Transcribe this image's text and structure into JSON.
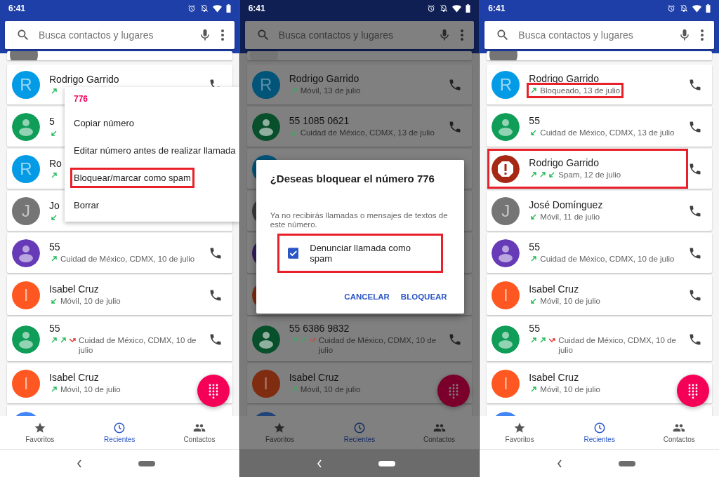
{
  "panels": [
    {
      "status_time": "6:41",
      "dimmed": false,
      "search": {
        "placeholder": "Busca contactos y lugares"
      },
      "calls": [
        {
          "kind": "partial_top",
          "avatar": {
            "kind": "plain",
            "color": "#757575"
          }
        },
        {
          "kind": "call",
          "avatar": {
            "kind": "letter",
            "letter": "R",
            "color": "#039be5"
          },
          "name": "Rodrigo Garrido",
          "arrows": [
            {
              "kind": "outgoing"
            }
          ]
        },
        {
          "kind": "call",
          "avatar": {
            "kind": "person",
            "color": "#0f9d58"
          },
          "name": "5",
          "arrows": [
            {
              "kind": "incoming"
            }
          ]
        },
        {
          "kind": "call",
          "avatar": {
            "kind": "letter",
            "letter": "R",
            "color": "#039be5"
          },
          "name": "Ro",
          "arrows": [
            {
              "kind": "outgoing"
            }
          ]
        },
        {
          "kind": "call",
          "avatar": {
            "kind": "letter",
            "letter": "J",
            "color": "#757575"
          },
          "name": "Jo",
          "arrows": [
            {
              "kind": "incoming"
            }
          ]
        },
        {
          "kind": "call",
          "avatar": {
            "kind": "person",
            "color": "#673ab7"
          },
          "name": "55",
          "arrows": [
            {
              "kind": "outgoing"
            }
          ],
          "subtitle": "Cuidad de México, CDMX, 10 de julio"
        },
        {
          "kind": "call",
          "avatar": {
            "kind": "letter",
            "letter": "I",
            "color": "#ff5722"
          },
          "name": "Isabel Cruz",
          "arrows": [
            {
              "kind": "incoming"
            }
          ],
          "subtitle": "Móvil, 10 de julio"
        },
        {
          "kind": "call",
          "avatar": {
            "kind": "person",
            "color": "#0f9d58"
          },
          "name": "55",
          "arrows": [
            {
              "kind": "outgoing"
            },
            {
              "kind": "outgoing"
            },
            {
              "kind": "missed"
            }
          ],
          "subtitle": "Cuidad de México, CDMX, 10 de julio"
        },
        {
          "kind": "call",
          "avatar": {
            "kind": "letter",
            "letter": "I",
            "color": "#ff5722"
          },
          "name": "Isabel Cruz",
          "arrows": [
            {
              "kind": "outgoing"
            }
          ],
          "subtitle": "Móvil, 10 de julio"
        },
        {
          "kind": "partial_bottom",
          "avatar": {
            "kind": "person",
            "color": "#4285f4"
          }
        }
      ],
      "menu": {
        "number": "776",
        "items": [
          {
            "label": "Copiar número",
            "highlighted": false
          },
          {
            "label": "Editar número antes de realizar llamada",
            "highlighted": false
          },
          {
            "label": "Bloquear/marcar como spam",
            "highlighted": true
          },
          {
            "label": "Borrar",
            "highlighted": false
          }
        ]
      },
      "nav": [
        {
          "kind": "star",
          "label": "Favoritos",
          "selected": false
        },
        {
          "kind": "clock",
          "label": "Recientes",
          "selected": true
        },
        {
          "kind": "people",
          "label": "Contactos",
          "selected": false
        }
      ]
    },
    {
      "status_time": "6:41",
      "dimmed": true,
      "search": {
        "placeholder": "Busca contactos y lugares"
      },
      "calls": [
        {
          "kind": "partial_top",
          "avatar": {
            "kind": "plain",
            "color": "#757575"
          }
        },
        {
          "kind": "call",
          "avatar": {
            "kind": "letter",
            "letter": "R",
            "color": "#025479"
          },
          "name": "Rodrigo Garrido",
          "arrows": [
            {
              "kind": "outgoing"
            }
          ],
          "subtitle": "Móvil, 13 de julio"
        },
        {
          "kind": "call",
          "avatar": {
            "kind": "person",
            "color": "#084f2c"
          },
          "name": "55 1085 0621",
          "arrows": [
            {
              "kind": "incoming"
            }
          ],
          "subtitle": "Cuidad de México, CDMX, 13 de julio"
        },
        {
          "kind": "call",
          "avatar": {
            "kind": "plain",
            "color": "#025479"
          }
        },
        {
          "kind": "call",
          "avatar": {
            "kind": "plain",
            "color": "#3b3b3b"
          }
        },
        {
          "kind": "call",
          "avatar": {
            "kind": "plain",
            "color": "#341d5c"
          }
        },
        {
          "kind": "call",
          "avatar": {
            "kind": "plain",
            "color": "#802c11"
          }
        },
        {
          "kind": "call",
          "avatar": {
            "kind": "person",
            "color": "#084f2c"
          },
          "name": "55 6386 9832",
          "arrows": [
            {
              "kind": "outgoing"
            },
            {
              "kind": "outgoing"
            },
            {
              "kind": "missed"
            }
          ],
          "subtitle": "Cuidad de México, CDMX, 10 de julio"
        },
        {
          "kind": "call",
          "avatar": {
            "kind": "letter",
            "letter": "I",
            "color": "#802c11"
          },
          "name": "Isabel Cruz",
          "arrows": [
            {
              "kind": "outgoing"
            }
          ],
          "subtitle": "Móvil, 10 de julio"
        },
        {
          "kind": "partial_bottom",
          "avatar": {
            "kind": "person",
            "color": "#21437a"
          }
        }
      ],
      "dialog": {
        "title": "¿Deseas bloquear el número 776",
        "message": "Ya no recibirás llamadas o mensajes de textos de este número.",
        "checkbox": {
          "label": "Denunciar llamada como spam",
          "checked": true,
          "highlighted": true
        },
        "buttons": [
          "CANCELAR",
          "BLOQUEAR"
        ]
      },
      "nav": [
        {
          "kind": "star",
          "label": "Favoritos",
          "selected": false
        },
        {
          "kind": "clock",
          "label": "Recientes",
          "selected": true
        },
        {
          "kind": "people",
          "label": "Contactos",
          "selected": false
        }
      ]
    },
    {
      "status_time": "6:41",
      "dimmed": false,
      "search": {
        "placeholder": "Busca contactos y lugares"
      },
      "calls": [
        {
          "kind": "partial_top",
          "avatar": {
            "kind": "plain",
            "color": "#757575"
          }
        },
        {
          "kind": "call",
          "avatar": {
            "kind": "letter",
            "letter": "R",
            "color": "#039be5"
          },
          "name": "Rodrigo Garrido",
          "arrows": [
            {
              "kind": "outgoing"
            }
          ],
          "subtitle": "Bloqueado, 13 de julio",
          "details_highlighted": true
        },
        {
          "kind": "call",
          "avatar": {
            "kind": "person",
            "color": "#0f9d58"
          },
          "name": "55",
          "arrows": [
            {
              "kind": "incoming"
            }
          ],
          "subtitle": "Cuidad de México, CDMX, 13 de julio"
        },
        {
          "kind": "call",
          "avatar": {
            "kind": "spam",
            "color": "#a52714"
          },
          "name": "Rodrigo Garrido",
          "arrows": [
            {
              "kind": "outgoing"
            },
            {
              "kind": "outgoing"
            },
            {
              "kind": "incoming"
            }
          ],
          "subtitle": "Spam, 12 de julio",
          "highlighted": true
        },
        {
          "kind": "call",
          "avatar": {
            "kind": "letter",
            "letter": "J",
            "color": "#757575"
          },
          "name": "José Domínguez",
          "arrows": [
            {
              "kind": "incoming"
            }
          ],
          "subtitle": "Móvil, 11 de julio"
        },
        {
          "kind": "call",
          "avatar": {
            "kind": "person",
            "color": "#673ab7"
          },
          "name": "55",
          "arrows": [
            {
              "kind": "outgoing"
            }
          ],
          "subtitle": "Cuidad de México, CDMX, 10 de julio"
        },
        {
          "kind": "call",
          "avatar": {
            "kind": "letter",
            "letter": "I",
            "color": "#ff5722"
          },
          "name": "Isabel Cruz",
          "arrows": [
            {
              "kind": "incoming"
            }
          ],
          "subtitle": "Móvil, 10 de julio"
        },
        {
          "kind": "call",
          "avatar": {
            "kind": "person",
            "color": "#0f9d58"
          },
          "name": "55",
          "arrows": [
            {
              "kind": "outgoing"
            },
            {
              "kind": "outgoing"
            },
            {
              "kind": "missed"
            }
          ],
          "subtitle": "Cuidad de México, CDMX, 10 de julio"
        },
        {
          "kind": "call",
          "avatar": {
            "kind": "letter",
            "letter": "I",
            "color": "#ff5722"
          },
          "name": "Isabel Cruz",
          "arrows": [
            {
              "kind": "outgoing"
            }
          ],
          "subtitle": "Móvil, 10 de julio"
        },
        {
          "kind": "partial_bottom",
          "avatar": {
            "kind": "person",
            "color": "#4285f4"
          }
        }
      ],
      "nav": [
        {
          "kind": "star",
          "label": "Favoritos",
          "selected": false
        },
        {
          "kind": "clock",
          "label": "Recientes",
          "selected": true
        },
        {
          "kind": "people",
          "label": "Contactos",
          "selected": false
        }
      ]
    }
  ]
}
